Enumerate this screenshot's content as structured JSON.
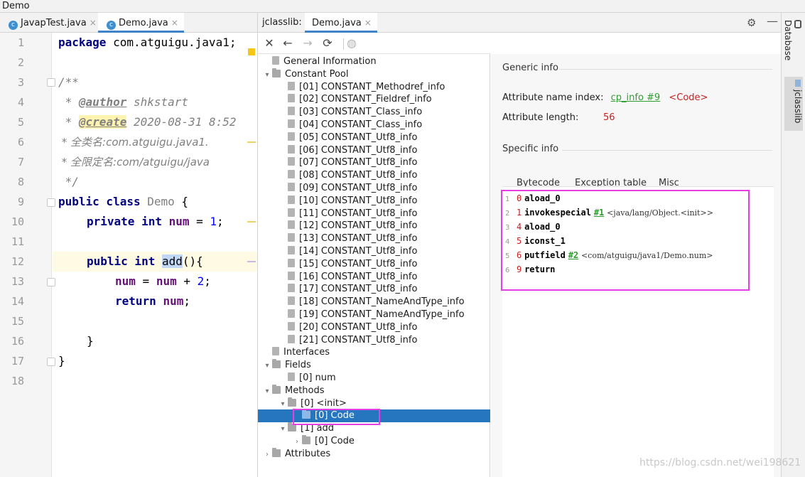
{
  "window": {
    "title": "Demo"
  },
  "editor": {
    "tabs": [
      {
        "label": "JavapTest.java",
        "active": false
      },
      {
        "label": "Demo.java",
        "active": true
      }
    ],
    "line_numbers": [
      "1",
      "2",
      "3",
      "4",
      "5",
      "6",
      "7",
      "8",
      "9",
      "10",
      "11",
      "12",
      "13",
      "14",
      "15",
      "16",
      "17",
      "18"
    ],
    "code": {
      "l1_kw": "package",
      "l1_rest": " com.atguigu.java1;",
      "l3": "/**",
      "l4_star": " * ",
      "l4_tag": "@author",
      "l4_rest": " shkstart",
      "l5_star": " * ",
      "l5_tag": "@create",
      "l5_rest": " 2020-08-31 8:52",
      "l6": " * 全类名:com.atguigu.java1.",
      "l7": " * 全限定名:com/atguigu/java",
      "l8": " */",
      "l9_kw": "public class",
      "l9_name": " Demo",
      "l9_rest": " {",
      "l10_kw": "private int",
      "l10_fld": " num",
      "l10_eq": " = ",
      "l10_num": "1",
      "l10_end": ";",
      "l12_kw": "public int",
      "l12_sp": " ",
      "l12_sel": "add",
      "l12_rest": "(){",
      "l13_fld": "num",
      "l13_eq": " = ",
      "l13_fld2": "num",
      "l13_plus": " + ",
      "l13_num": "2",
      "l13_end": ";",
      "l14_kw": "return",
      "l14_sp": " ",
      "l14_fld": "num",
      "l14_end": ";",
      "l16": "}",
      "l17": "}"
    }
  },
  "jclasslib": {
    "tab_label": "jclasslib:",
    "tab_file": "Demo.java",
    "toolbar": [
      "close",
      "back",
      "forward",
      "refresh",
      "web"
    ],
    "tree": [
      {
        "label": "General Information",
        "kind": "doc",
        "level": 1,
        "arrow": ""
      },
      {
        "label": "Constant Pool",
        "kind": "folder",
        "level": 1,
        "arrow": "▾"
      },
      {
        "label": "[01] CONSTANT_Methodref_info",
        "kind": "doc",
        "level": 2,
        "arrow": ""
      },
      {
        "label": "[02] CONSTANT_Fieldref_info",
        "kind": "doc",
        "level": 2,
        "arrow": ""
      },
      {
        "label": "[03] CONSTANT_Class_info",
        "kind": "doc",
        "level": 2,
        "arrow": ""
      },
      {
        "label": "[04] CONSTANT_Class_info",
        "kind": "doc",
        "level": 2,
        "arrow": ""
      },
      {
        "label": "[05] CONSTANT_Utf8_info",
        "kind": "doc",
        "level": 2,
        "arrow": ""
      },
      {
        "label": "[06] CONSTANT_Utf8_info",
        "kind": "doc",
        "level": 2,
        "arrow": ""
      },
      {
        "label": "[07] CONSTANT_Utf8_info",
        "kind": "doc",
        "level": 2,
        "arrow": ""
      },
      {
        "label": "[08] CONSTANT_Utf8_info",
        "kind": "doc",
        "level": 2,
        "arrow": ""
      },
      {
        "label": "[09] CONSTANT_Utf8_info",
        "kind": "doc",
        "level": 2,
        "arrow": ""
      },
      {
        "label": "[10] CONSTANT_Utf8_info",
        "kind": "doc",
        "level": 2,
        "arrow": ""
      },
      {
        "label": "[11] CONSTANT_Utf8_info",
        "kind": "doc",
        "level": 2,
        "arrow": ""
      },
      {
        "label": "[12] CONSTANT_Utf8_info",
        "kind": "doc",
        "level": 2,
        "arrow": ""
      },
      {
        "label": "[13] CONSTANT_Utf8_info",
        "kind": "doc",
        "level": 2,
        "arrow": ""
      },
      {
        "label": "[14] CONSTANT_Utf8_info",
        "kind": "doc",
        "level": 2,
        "arrow": ""
      },
      {
        "label": "[15] CONSTANT_Utf8_info",
        "kind": "doc",
        "level": 2,
        "arrow": ""
      },
      {
        "label": "[16] CONSTANT_Utf8_info",
        "kind": "doc",
        "level": 2,
        "arrow": ""
      },
      {
        "label": "[17] CONSTANT_Utf8_info",
        "kind": "doc",
        "level": 2,
        "arrow": ""
      },
      {
        "label": "[18] CONSTANT_NameAndType_info",
        "kind": "doc",
        "level": 2,
        "arrow": ""
      },
      {
        "label": "[19] CONSTANT_NameAndType_info",
        "kind": "doc",
        "level": 2,
        "arrow": ""
      },
      {
        "label": "[20] CONSTANT_Utf8_info",
        "kind": "doc",
        "level": 2,
        "arrow": ""
      },
      {
        "label": "[21] CONSTANT_Utf8_info",
        "kind": "doc",
        "level": 2,
        "arrow": ""
      },
      {
        "label": "Interfaces",
        "kind": "doc",
        "level": 1,
        "arrow": ""
      },
      {
        "label": "Fields",
        "kind": "folder",
        "level": 1,
        "arrow": "▾"
      },
      {
        "label": "[0] num",
        "kind": "doc",
        "level": 2,
        "arrow": ""
      },
      {
        "label": "Methods",
        "kind": "folder",
        "level": 1,
        "arrow": "▾"
      },
      {
        "label": "[0] <init>",
        "kind": "folder",
        "level": 2,
        "arrow": "▾"
      },
      {
        "label": "[0] Code",
        "kind": "folder",
        "level": 3,
        "arrow": "",
        "selected": true
      },
      {
        "label": "[1] add",
        "kind": "folder",
        "level": 2,
        "arrow": "▾"
      },
      {
        "label": "[0] Code",
        "kind": "folder",
        "level": 3,
        "arrow": "›"
      },
      {
        "label": "Attributes",
        "kind": "folder",
        "level": 1,
        "arrow": "›"
      }
    ],
    "detail": {
      "generic_info": "Generic info",
      "attr_name_label": "Attribute name index:",
      "attr_name_link": "cp_info #9",
      "attr_name_value": "<Code>",
      "attr_len_label": "Attribute length:",
      "attr_len_value": "56",
      "specific_info": "Specific info",
      "subtabs": [
        "Bytecode",
        "Exception table",
        "Misc"
      ],
      "bytecode": [
        {
          "n": "1",
          "off": "0",
          "op": "aload_0",
          "ref": "",
          "comment": ""
        },
        {
          "n": "2",
          "off": "1",
          "op": "invokespecial",
          "ref": "#1",
          "comment": "<java/lang/Object.<init>>"
        },
        {
          "n": "3",
          "off": "4",
          "op": "aload_0",
          "ref": "",
          "comment": ""
        },
        {
          "n": "4",
          "off": "5",
          "op": "iconst_1",
          "ref": "",
          "comment": ""
        },
        {
          "n": "5",
          "off": "6",
          "op": "putfield",
          "ref": "#2",
          "comment": "<com/atguigu/java1/Demo.num>"
        },
        {
          "n": "6",
          "off": "9",
          "op": "return",
          "ref": "",
          "comment": ""
        }
      ]
    }
  },
  "sidebar": {
    "tabs": [
      "Database",
      "jclasslib"
    ]
  },
  "watermark": "https://blog.csdn.net/wei198621",
  "colors": {
    "selection": "#2675bf",
    "highlight_box": "#e53ee5",
    "link": "#2e9e2e",
    "value_red": "#c81e1e"
  }
}
